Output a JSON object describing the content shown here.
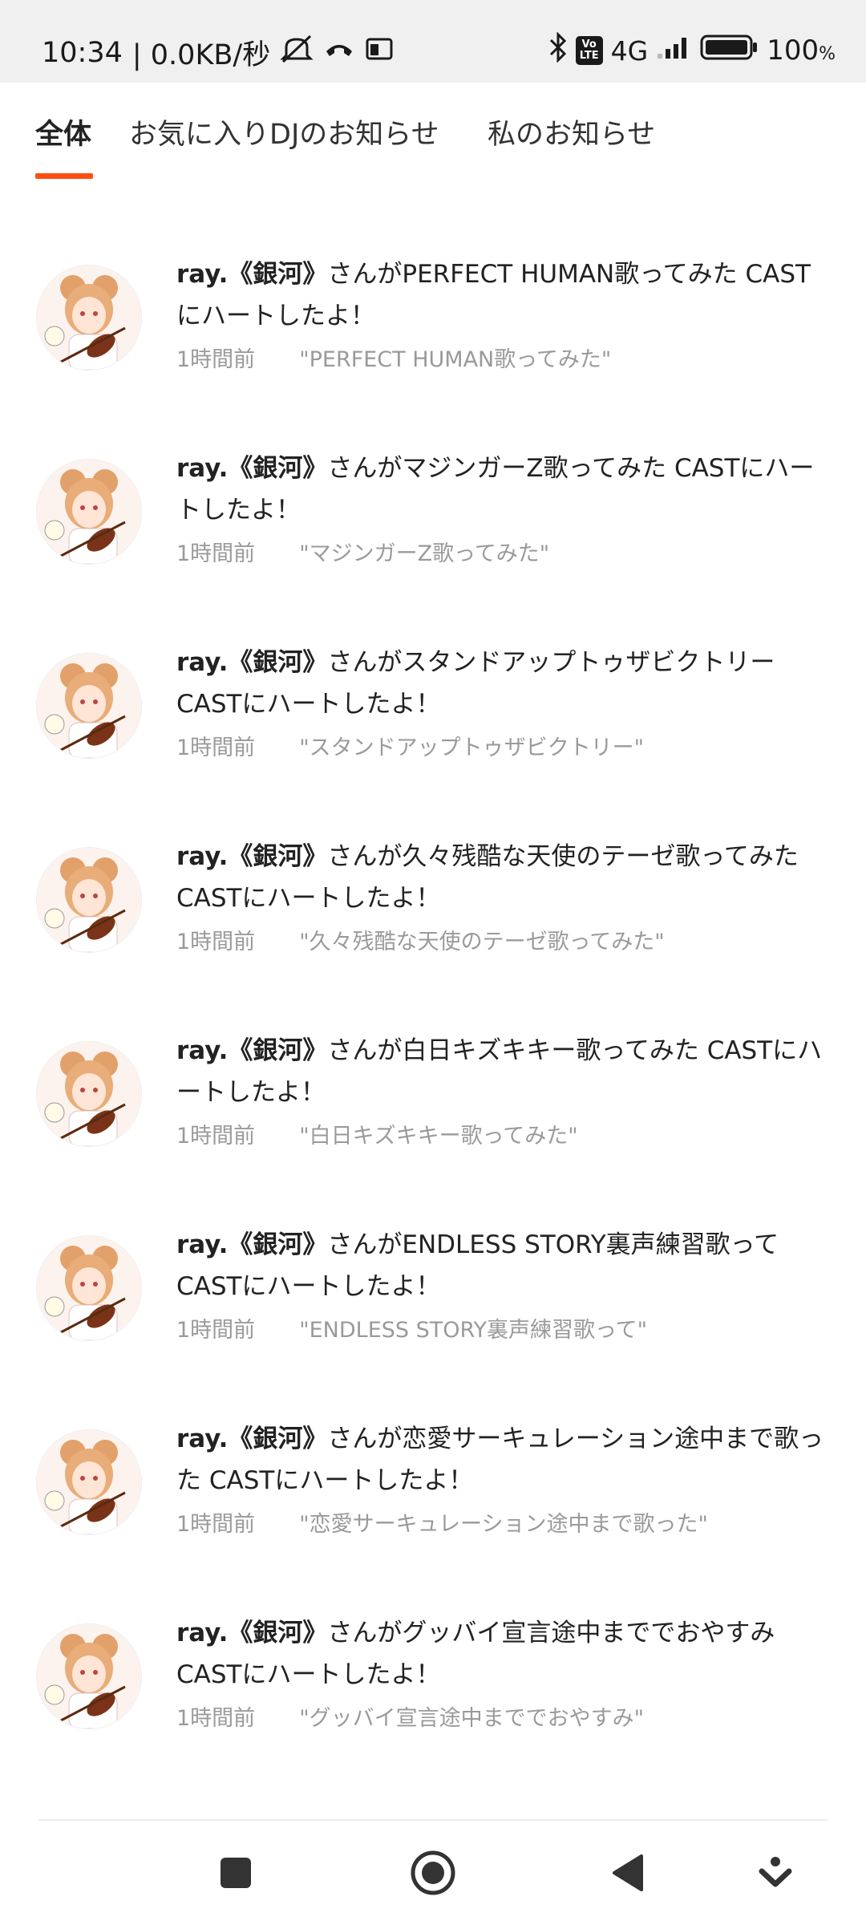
{
  "status_bar": {
    "time": "10:34",
    "net_speed": "| 0.0KB/秒",
    "network": "4G",
    "volte_top": "Vo",
    "volte_bottom": "LTE",
    "battery": "100",
    "battery_unit": "%",
    "icons": [
      "mute-icon",
      "call-icon",
      "au-icon",
      "bluetooth-icon",
      "signal-icon",
      "battery-icon"
    ]
  },
  "tabs": [
    {
      "label": "全体",
      "active": true
    },
    {
      "label": "お気に入りDJのお知らせ",
      "active": false
    },
    {
      "label": "私のお知らせ",
      "active": false
    }
  ],
  "accent_color": "#ff4e12",
  "notifications": [
    {
      "user": "ray.《銀河》",
      "message": "さんがPERFECT HUMAN歌ってみた CASTにハートしたよ！",
      "time": "1時間前",
      "cast": "\"PERFECT HUMAN歌ってみた\""
    },
    {
      "user": "ray.《銀河》",
      "message": "さんがマジンガーZ歌ってみた CASTにハートしたよ！",
      "time": "1時間前",
      "cast": "\"マジンガーZ歌ってみた\""
    },
    {
      "user": "ray.《銀河》",
      "message": "さんがスタンドアップトゥザビクトリー CASTにハートしたよ！",
      "time": "1時間前",
      "cast": "\"スタンドアップトゥザビクトリー\""
    },
    {
      "user": "ray.《銀河》",
      "message": "さんが久々残酷な天使のテーゼ歌ってみた CASTにハートしたよ！",
      "time": "1時間前",
      "cast": "\"久々残酷な天使のテーゼ歌ってみた\""
    },
    {
      "user": "ray.《銀河》",
      "message": "さんが白日キズキキー歌ってみた CASTにハートしたよ！",
      "time": "1時間前",
      "cast": "\"白日キズキキー歌ってみた\""
    },
    {
      "user": "ray.《銀河》",
      "message": "さんがENDLESS STORY裏声練習歌って CASTにハートしたよ！",
      "time": "1時間前",
      "cast": "\"ENDLESS STORY裏声練習歌って\""
    },
    {
      "user": "ray.《銀河》",
      "message": "さんが恋愛サーキュレーション途中まで歌った CASTにハートしたよ！",
      "time": "1時間前",
      "cast": "\"恋愛サーキュレーション途中まで歌った\""
    },
    {
      "user": "ray.《銀河》",
      "message": "さんがグッバイ宣言途中まででおやすみ CASTにハートしたよ！",
      "time": "1時間前",
      "cast": "\"グッバイ宣言途中まででおやすみ\""
    }
  ],
  "navbar": {
    "icons": [
      "recents-square-icon",
      "home-circle-icon",
      "back-triangle-icon",
      "notification-pull-icon"
    ]
  }
}
